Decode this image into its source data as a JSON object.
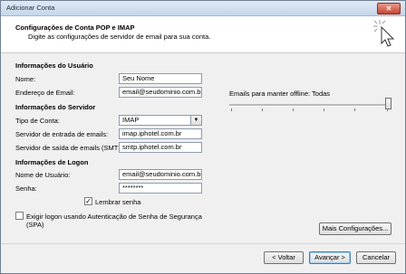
{
  "window": {
    "title": "Adicionar Conta",
    "close_glyph": "✕"
  },
  "header": {
    "title": "Configurações de Conta POP e IMAP",
    "subtitle": "Digite as configurações de servidor de email para sua conta."
  },
  "user_info": {
    "section": "Informações do Usuário",
    "name_label": "Nome:",
    "name_value": "Seu Nome",
    "email_label": "Endereço de Email:",
    "email_value": "email@seudominio.com.br"
  },
  "server_info": {
    "section": "Informações do Servidor",
    "type_label": "Tipo de Conta:",
    "type_value": "IMAP",
    "incoming_label": "Servidor de entrada de emails:",
    "incoming_value": "imap.iphotel.com.br",
    "outgoing_label": "Servidor de saída de emails (SMTP):",
    "outgoing_value": "smtp.iphotel.com.br"
  },
  "logon_info": {
    "section": "Informações de Logon",
    "username_label": "Nome de Usuário:",
    "username_value": "email@seudominio.com.br",
    "password_label": "Senha:",
    "password_value": "********",
    "remember_label": "Lembrar senha",
    "remember_checked": true,
    "spa_label_line1": "Exigir logon usando Autenticação de Senha de Segurança",
    "spa_label_line2": "(SPA)",
    "spa_checked": false
  },
  "offline": {
    "label": "Emails para manter offline:",
    "value": "Todas",
    "slider_fraction": 1.0
  },
  "buttons": {
    "more_settings": "Mais Configurações...",
    "back": "< Voltar",
    "next": "Avançar >",
    "cancel": "Cancelar"
  },
  "icons": {
    "check": "✓",
    "dropdown": "▼"
  }
}
